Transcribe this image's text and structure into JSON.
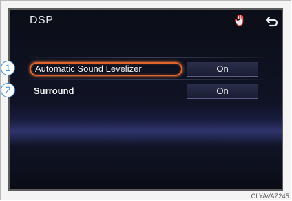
{
  "screen": {
    "title": "DSP",
    "icons": {
      "hand": "hand-touch-icon",
      "back": "back-arrow-icon"
    }
  },
  "items": [
    {
      "number": "1",
      "label": "Automatic Sound Levelizer",
      "value": "On",
      "selected": true
    },
    {
      "number": "2",
      "label": "Surround",
      "value": "On",
      "selected": false
    }
  ],
  "caption": "CLYAVAZ245",
  "colors": {
    "highlight": "#e0632a",
    "badge": "#3d8fd6",
    "screen_bg": "#0b0d17"
  }
}
